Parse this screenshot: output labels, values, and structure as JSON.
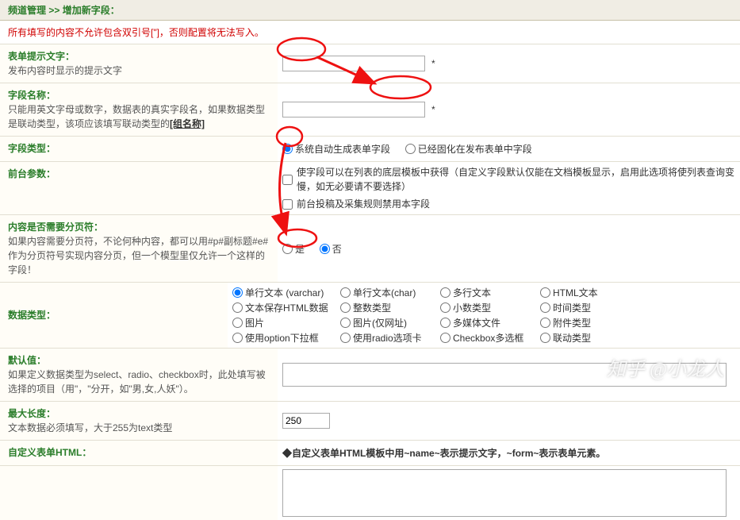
{
  "breadcrumb": {
    "cat": "频道管理",
    "sep": " >> ",
    "page": "增加新字段："
  },
  "warning": "所有填写的内容不允许包含双引号[\"]，否则配置将无法写入。",
  "row1": {
    "title": "表单提示文字：",
    "desc": "发布内容时显示的提示文字",
    "value": "",
    "star": "*"
  },
  "row2": {
    "title": "字段名称：",
    "desc_a": "只能用英文字母或数字，数据表的真实字段名，如果数据类型是联动类型，该项应该填写联动类型的",
    "desc_b": "[组名称]",
    "value": "",
    "star": "*"
  },
  "row3": {
    "title": "字段类型：",
    "opt_auto": "系统自动生成表单字段",
    "opt_fixed": "已经固化在发布表单中字段"
  },
  "row4": {
    "title": "前台参数：",
    "chk1": "使字段可以在列表的底层模板中获得（自定义字段默认仅能在文档模板显示，启用此选项将使列表查询变慢，如无必要请不要选择）",
    "chk2": "前台投稿及采集规则禁用本字段"
  },
  "row5": {
    "title": "内容是否需要分页符：",
    "desc": "如果内容需要分页符，不论何种内容，都可以用#p#副标题#e#作为分页符号实现内容分页，但一个模型里仅允许一个这样的字段！",
    "opt_yes": "是",
    "opt_no": "否"
  },
  "row6": {
    "title": "数据类型：",
    "opts": [
      "单行文本 (varchar)",
      "单行文本(char)",
      "多行文本",
      "HTML文本",
      "文本保存HTML数据",
      "整数类型",
      "小数类型",
      "时间类型",
      "图片",
      "图片(仅网址)",
      "多媒体文件",
      "附件类型",
      "使用option下拉框",
      "使用radio选项卡",
      "Checkbox多选框",
      "联动类型"
    ]
  },
  "row7": {
    "title": "默认值：",
    "desc": "如果定义数据类型为select、radio、checkbox时，此处填写被选择的项目（用\"，\"分开，如\"男,女,人妖\"）。",
    "value": ""
  },
  "row8": {
    "title": "最大长度：",
    "desc": "文本数据必须填写，大于255为text类型",
    "value": "250"
  },
  "row9": {
    "title": "自定义表单HTML：",
    "note": "◆自定义表单HTML模板中用~name~表示提示文字，~form~表示表单元素。",
    "value": ""
  },
  "watermark": "知乎 @小龙人"
}
